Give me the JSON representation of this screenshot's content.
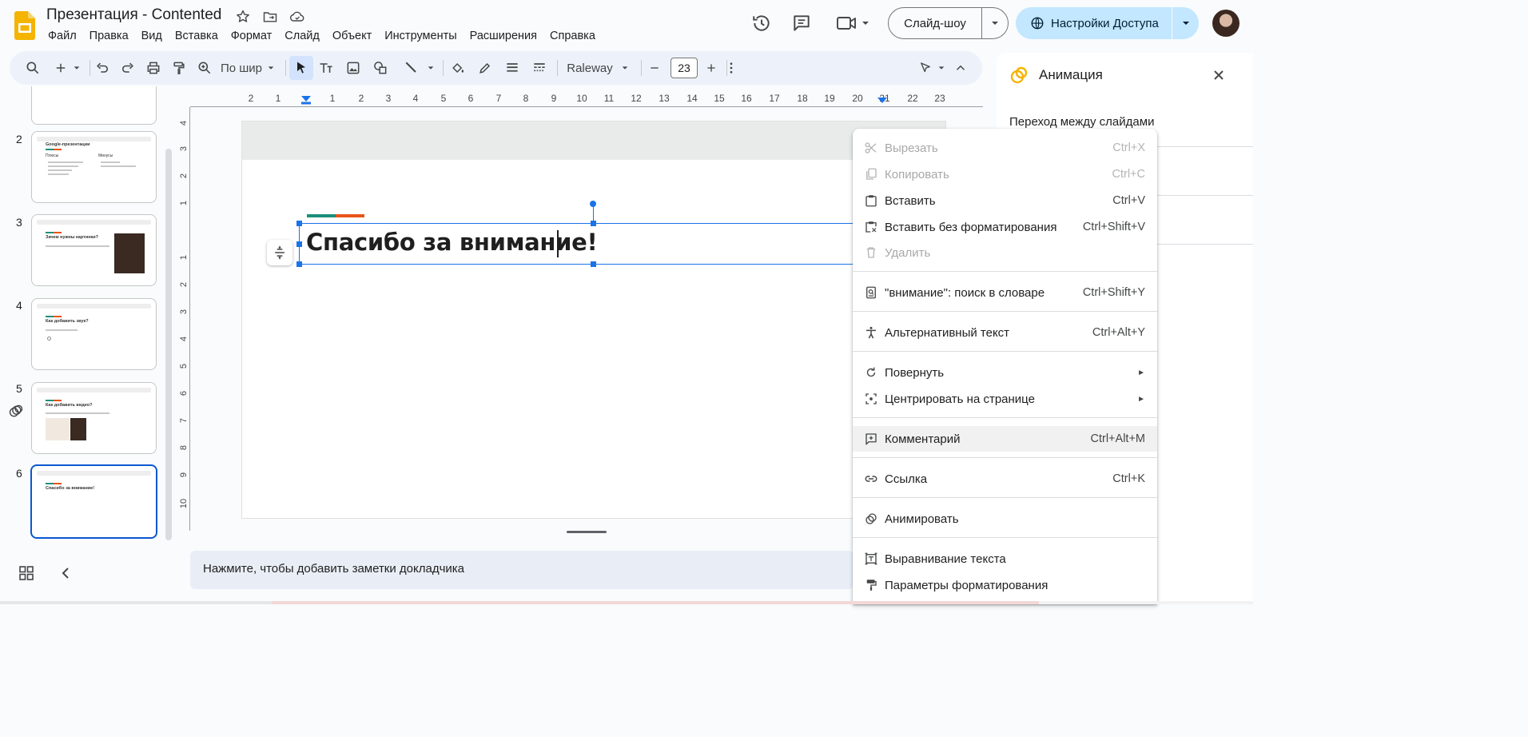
{
  "app": {
    "doc_title": "Презентация - Contented"
  },
  "menu": [
    "Файл",
    "Правка",
    "Вид",
    "Вставка",
    "Формат",
    "Слайд",
    "Объект",
    "Инструменты",
    "Расширения",
    "Справка"
  ],
  "header": {
    "slideshow_label": "Слайд-шоу",
    "share_label": "Настройки Доступа"
  },
  "toolbar": {
    "zoom_label": "По шир",
    "font_name": "Raleway",
    "font_size": "23"
  },
  "ruler": {
    "h": [
      "2",
      "1",
      "1",
      "2",
      "3",
      "4",
      "5",
      "6",
      "7",
      "8",
      "9",
      "10",
      "11",
      "12",
      "13",
      "14",
      "15",
      "16",
      "17",
      "18",
      "19",
      "20",
      "21",
      "22",
      "23"
    ],
    "v": [
      "4",
      "3",
      "2",
      "1",
      "1",
      "2",
      "3",
      "4",
      "5",
      "6",
      "7",
      "8",
      "9",
      "10"
    ]
  },
  "filmstrip": {
    "slides": [
      {
        "num": "2",
        "title": "Google-презентации",
        "col1": "Плюсы",
        "col2": "Минусы"
      },
      {
        "num": "3",
        "title": "Зачем нужны картинки?"
      },
      {
        "num": "4",
        "title": "Как добавить звук?"
      },
      {
        "num": "5",
        "title": "Как добавить видео?"
      },
      {
        "num": "6",
        "title": "Спасибо за внимание!"
      }
    ]
  },
  "slide": {
    "title": "Спасибо за внимание!"
  },
  "notes": {
    "placeholder": "Нажмите, чтобы добавить заметки докладчика"
  },
  "panel": {
    "title": "Анимация",
    "subtitle": "Переход между слайдами"
  },
  "context_menu": {
    "items": [
      {
        "label": "Вырезать",
        "shortcut": "Ctrl+X",
        "icon": "scissors-icon",
        "disabled": true
      },
      {
        "label": "Копировать",
        "shortcut": "Ctrl+C",
        "icon": "copy-icon",
        "disabled": true
      },
      {
        "label": "Вставить",
        "shortcut": "Ctrl+V",
        "icon": "paste-icon",
        "disabled": false
      },
      {
        "label": "Вставить без форматирования",
        "shortcut": "Ctrl+Shift+V",
        "icon": "paste-plain-icon",
        "disabled": false
      },
      {
        "label": "Удалить",
        "shortcut": "",
        "icon": "trash-icon",
        "disabled": true
      },
      {
        "label": "\"внимание\": поиск в словаре",
        "shortcut": "Ctrl+Shift+Y",
        "icon": "dictionary-icon",
        "disabled": false
      },
      {
        "label": "Альтернативный текст",
        "shortcut": "Ctrl+Alt+Y",
        "icon": "accessibility-icon",
        "disabled": false
      },
      {
        "label": "Повернуть",
        "shortcut": "",
        "icon": "rotate-icon",
        "submenu": true
      },
      {
        "label": "Центрировать на странице",
        "shortcut": "",
        "icon": "center-icon",
        "submenu": true
      },
      {
        "label": "Комментарий",
        "shortcut": "Ctrl+Alt+M",
        "icon": "add-comment-icon",
        "hover": true
      },
      {
        "label": "Ссылка",
        "shortcut": "Ctrl+K",
        "icon": "link-icon"
      },
      {
        "label": "Анимировать",
        "shortcut": "",
        "icon": "animate-icon"
      },
      {
        "label": "Выравнивание текста",
        "shortcut": "",
        "icon": "text-fit-icon"
      },
      {
        "label": "Параметры форматирования",
        "shortcut": "",
        "icon": "format-paint-icon"
      }
    ]
  },
  "colors": {
    "accent_blue": "#1a73e8",
    "share_bg": "#c2e7ff",
    "toolbar_bg": "#edf2fa",
    "bar_green": "#1b8e7b",
    "bar_orange": "#e8541a"
  }
}
